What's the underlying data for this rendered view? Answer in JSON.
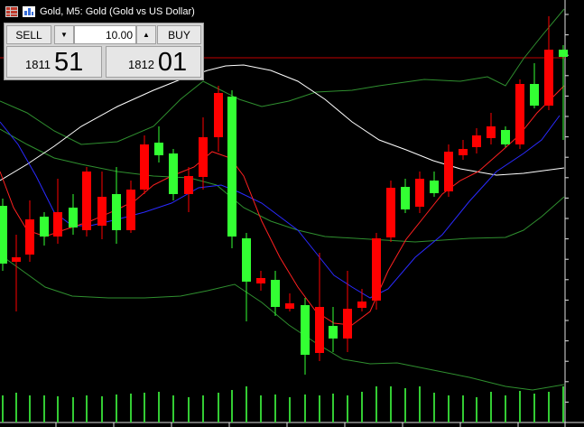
{
  "header": {
    "title": "Gold, M5:  Gold (Gold vs US Dollar)",
    "table_icon": "table-icon",
    "chart_icon": "chart-icon"
  },
  "trade_panel": {
    "sell_label": "SELL",
    "buy_label": "BUY",
    "lot_value": "10.00",
    "spin_down": "▼",
    "spin_up": "▲",
    "sell_price_small": "1811",
    "sell_price_big": "51",
    "buy_price_small": "1812",
    "buy_price_big": "01"
  },
  "colors": {
    "background": "#000000",
    "bull_candle": "#33ff33",
    "bear_candle": "#ff0000",
    "volume": "#33cc33",
    "ma_fast": "#ff2020",
    "ma_slow": "#2a2aff",
    "bollinger": "#2f8f2f",
    "ma_long": "#ffffff",
    "price_line": "#c00000"
  }
}
